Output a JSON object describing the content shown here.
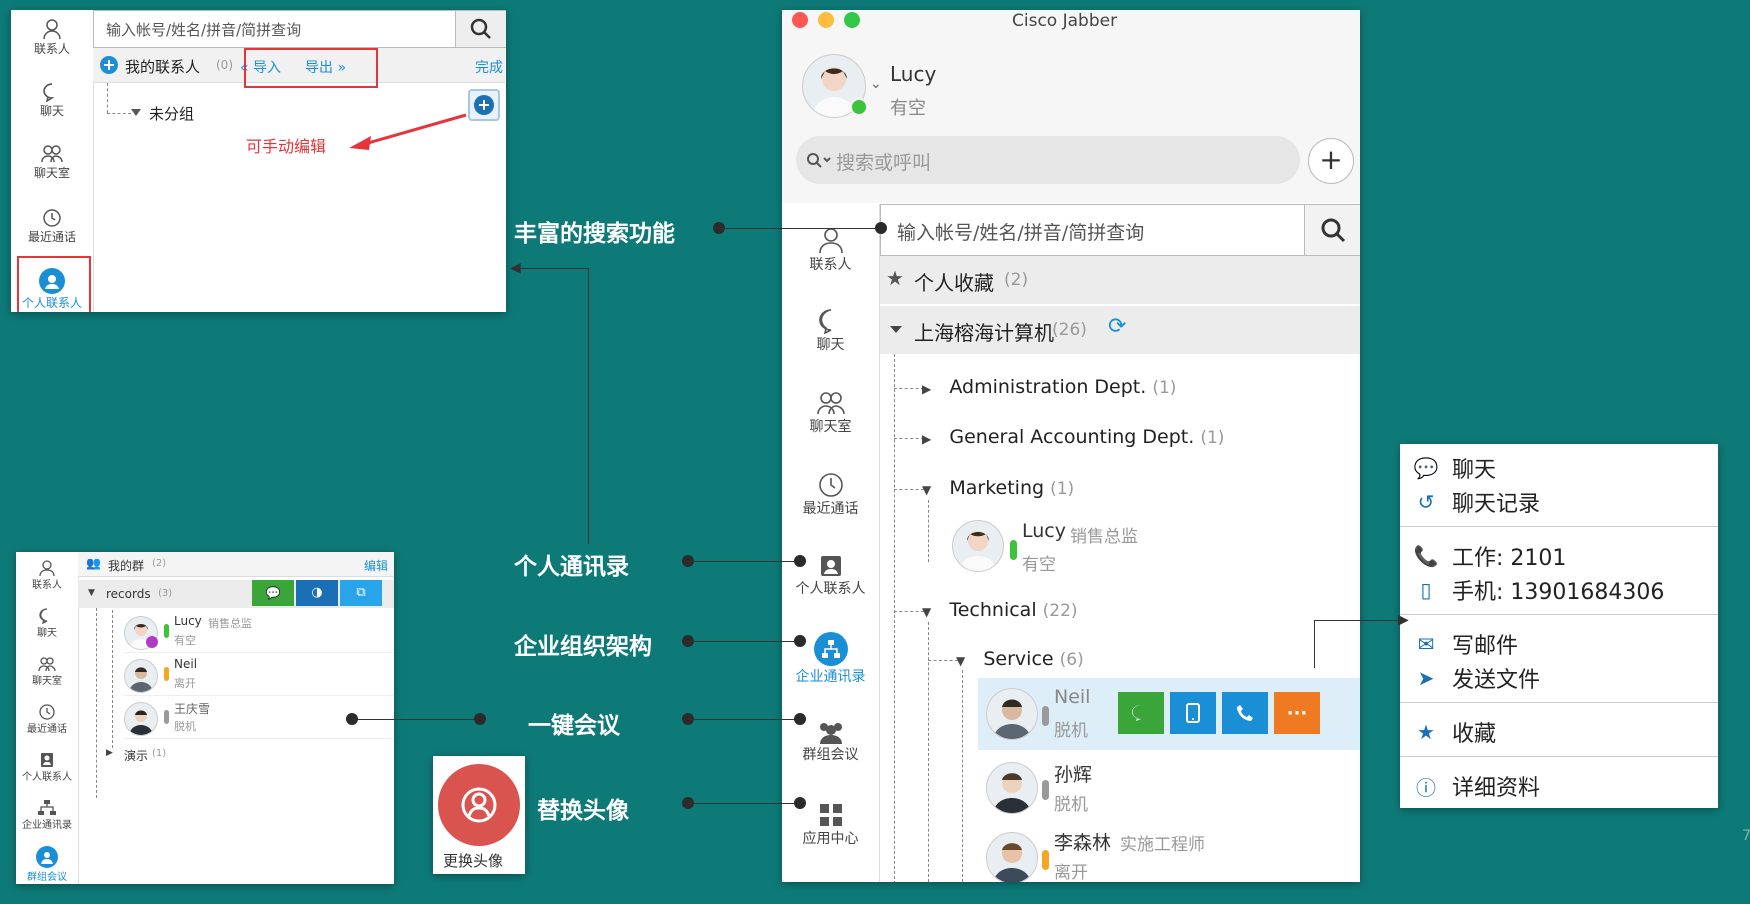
{
  "panel_personal": {
    "search_placeholder": "输入帐号/姓名/拼音/简拼查询",
    "nav": [
      "联系人",
      "聊天",
      "聊天室",
      "最近通话",
      "个人联系人"
    ],
    "group_title": "我的联系人",
    "group_count": "(0)",
    "import": "« 导入",
    "export": "导出 »",
    "done": "完成",
    "ungrouped": "未分组",
    "annotation": "可手动编辑"
  },
  "panel_jabber": {
    "window_title": "Cisco Jabber",
    "user_name": "Lucy",
    "user_status": "有空",
    "search_call_placeholder": "搜索或呼叫",
    "search_placeholder": "输入帐号/姓名/拼音/简拼查询",
    "favorites": "个人收藏",
    "favorites_count": "(2)",
    "company": "上海榕海计算机",
    "company_count": "(26)",
    "nav": [
      "联系人",
      "聊天",
      "聊天室",
      "最近通话",
      "个人联系人",
      "企业通讯录",
      "群组会议",
      "应用中心"
    ],
    "depts": [
      {
        "name": "Administration Dept.",
        "count": "(1)"
      },
      {
        "name": "General Accounting Dept.",
        "count": "(1)"
      },
      {
        "name": "Marketing",
        "count": "(1)"
      },
      {
        "name": "Technical",
        "count": "(22)"
      },
      {
        "name": "Service",
        "count": "(6)"
      }
    ],
    "contacts": [
      {
        "name": "Lucy",
        "title": "销售总监",
        "status": "有空",
        "color": "#3bc43b"
      },
      {
        "name": "Neil",
        "title": "",
        "status": "脱机",
        "color": "#9a9a9a"
      },
      {
        "name": "孙辉",
        "title": "",
        "status": "脱机",
        "color": "#9a9a9a"
      },
      {
        "name": "李森林",
        "title": "实施工程师",
        "status": "离开",
        "color": "#f5a623"
      }
    ]
  },
  "panel_group": {
    "nav": [
      "联系人",
      "聊天",
      "聊天室",
      "最近通话",
      "个人联系人",
      "企业通讯录",
      "群组会议"
    ],
    "title": "我的群",
    "title_count": "(2)",
    "edit": "编辑",
    "group1": "records",
    "group1_count": "(3)",
    "group2": "演示",
    "group2_count": "(1)",
    "members": [
      {
        "name": "Lucy",
        "title": "销售总监",
        "status": "有空",
        "color": "#3bc43b"
      },
      {
        "name": "Neil",
        "title": "",
        "status": "离开",
        "color": "#f5a623"
      },
      {
        "name": "王庆雪",
        "title": "",
        "status": "脱机",
        "color": "#9a9a9a"
      }
    ]
  },
  "context_menu": {
    "chat": "聊天",
    "history": "聊天记录",
    "work": "工作: 2101",
    "mobile": "手机: 13901684306",
    "email": "写邮件",
    "send_file": "发送文件",
    "favorite": "收藏",
    "details": "详细资料"
  },
  "features": {
    "search": "丰富的搜索功能",
    "personal": "个人通讯录",
    "enterprise": "企业组织架构",
    "meeting": "一键会议",
    "avatar": "替换头像"
  },
  "avatar_tile": "更换头像",
  "page_number": "7",
  "colors": {
    "background": "#0e7a78",
    "accent": "#1a8fd6",
    "highlight": "#e5353a"
  }
}
